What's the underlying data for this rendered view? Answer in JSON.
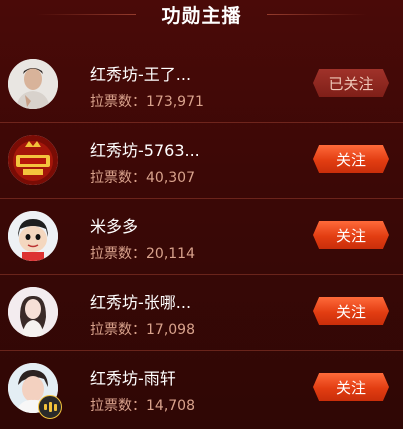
{
  "header": {
    "title": "功勋主播"
  },
  "streamers": [
    {
      "name": "红秀坊-王了...",
      "votes_label": "拉票数：",
      "votes": "173,971",
      "button": "已关注",
      "followed": true
    },
    {
      "name": "红秀坊-5763...",
      "votes_label": "拉票数：",
      "votes": "40,307",
      "button": "关注",
      "followed": false
    },
    {
      "name": "米多多",
      "votes_label": "拉票数：",
      "votes": "20,114",
      "button": "关注",
      "followed": false
    },
    {
      "name": "红秀坊-张哪...",
      "votes_label": "拉票数：",
      "votes": "17,098",
      "button": "关注",
      "followed": false
    },
    {
      "name": "红秀坊-雨轩",
      "votes_label": "拉票数：",
      "votes": "14,708",
      "button": "关注",
      "followed": false
    }
  ],
  "colors": {
    "follow": "#e23d12",
    "followed": "#7f1f18",
    "votes_text": "#d9a28c"
  }
}
